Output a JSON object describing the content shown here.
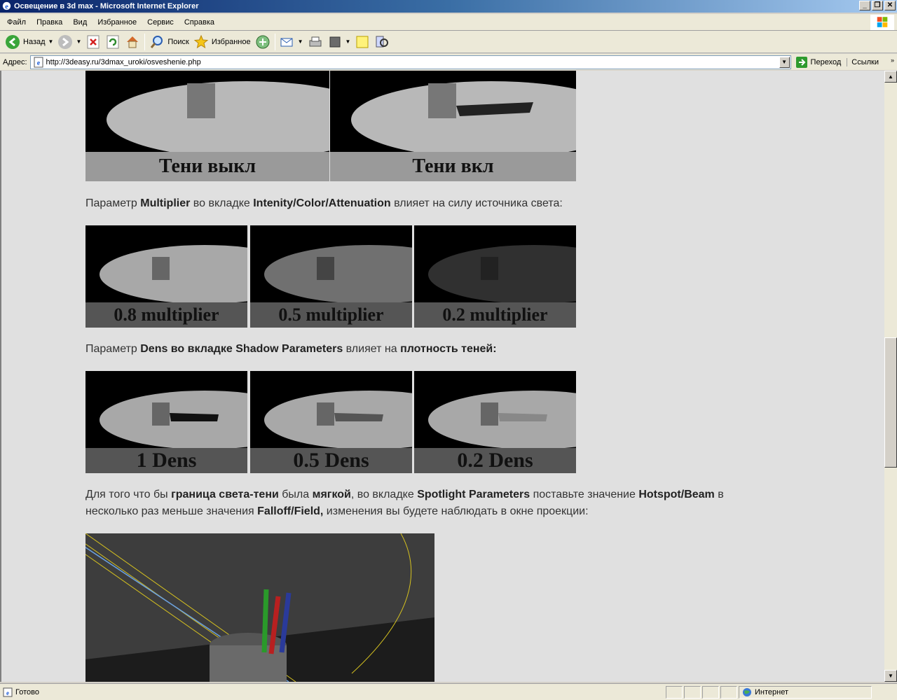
{
  "window": {
    "title": "Освещение в 3d max - Microsoft Internet Explorer",
    "minimize": "_",
    "maximize": "❐",
    "close": "✕"
  },
  "menu": [
    "Файл",
    "Правка",
    "Вид",
    "Избранное",
    "Сервис",
    "Справка"
  ],
  "toolbar": {
    "back": "Назад",
    "search": "Поиск",
    "favorites": "Избранное"
  },
  "address": {
    "label": "Адрес:",
    "url": "http://3deasy.ru/3dmax_uroki/osveshenie.php",
    "go": "Переход",
    "links": "Ссылки"
  },
  "content": {
    "shadow_images": [
      "Тени выкл",
      "Тени вкл"
    ],
    "para1": {
      "t1": "Параметр ",
      "b1": "Multiplier",
      "t2": " во вкладке ",
      "b2": "Intenity/Color/Attenuation",
      "t3": " влияет на силу источника света:"
    },
    "multiplier_images": [
      "0.8 multiplier",
      "0.5 multiplier",
      "0.2 multiplier"
    ],
    "para2": {
      "t1": "Параметр ",
      "b1": "Dens во вкладке Shadow Parameters",
      "t2": " влияет на ",
      "b2": "плотность теней:"
    },
    "dens_images": [
      "1 Dens",
      "0.5 Dens",
      "0.2 Dens"
    ],
    "para3": {
      "t1": "Для того что бы ",
      "b1": "граница света-тени",
      "t2": " была ",
      "b2": "мягкой",
      "t3": ", во вкладке ",
      "b3": "Spotlight Parameters",
      "t4": " поставьте значение ",
      "b4": "Hotspot/Beam",
      "t5": " в несколько раз меньше значения ",
      "b5": "Falloff/Field,",
      "t6": " изменения вы будете наблюдать в окне проекции:"
    }
  },
  "status": {
    "text": "Готово",
    "zone": "Интернет"
  }
}
